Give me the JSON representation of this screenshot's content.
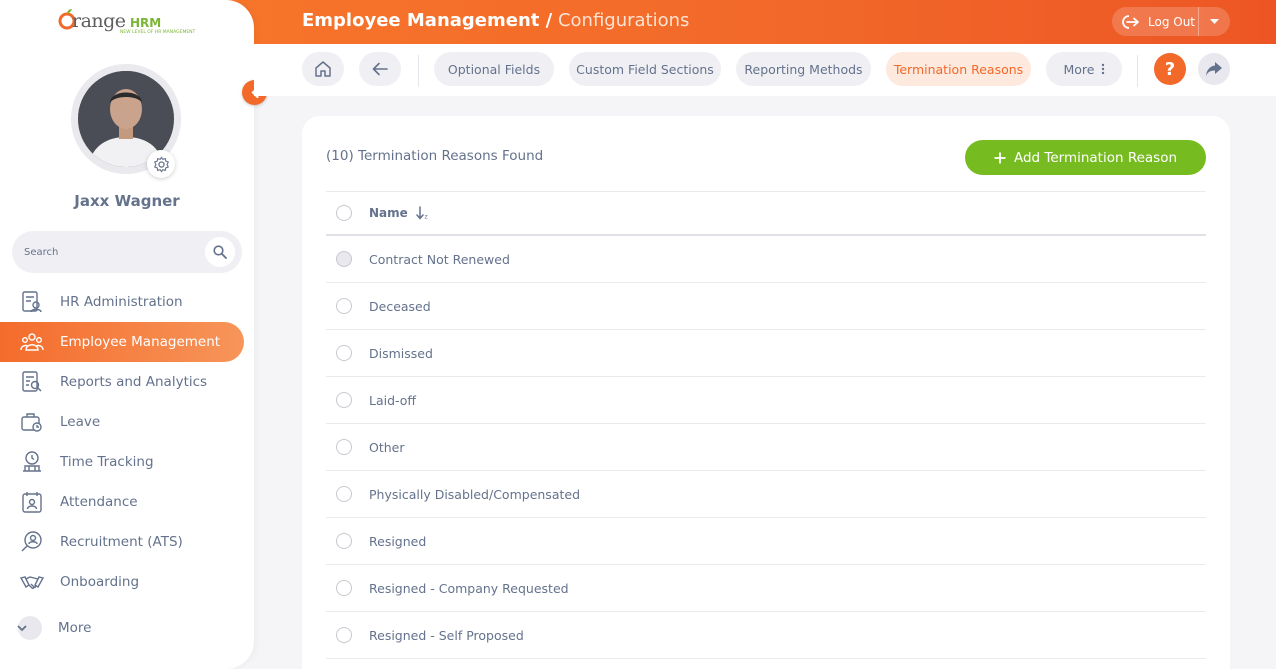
{
  "app": {
    "logo_main": "range",
    "logo_brand": "HRM",
    "logo_tagline": "NEW LEVEL OF HR MANAGEMENT"
  },
  "header": {
    "title": "Employee Management /",
    "subtitle": "Configurations",
    "logout_label": "Log Out"
  },
  "user": {
    "name": "Jaxx Wagner"
  },
  "search": {
    "placeholder": "Search"
  },
  "sidebar": {
    "items": [
      {
        "label": "HR Administration",
        "icon": "hr-admin-icon"
      },
      {
        "label": "Employee Management",
        "icon": "employees-icon",
        "active": true
      },
      {
        "label": "Reports and Analytics",
        "icon": "reports-icon"
      },
      {
        "label": "Leave",
        "icon": "leave-icon"
      },
      {
        "label": "Time Tracking",
        "icon": "time-tracking-icon"
      },
      {
        "label": "Attendance",
        "icon": "attendance-icon"
      },
      {
        "label": "Recruitment (ATS)",
        "icon": "recruitment-icon"
      },
      {
        "label": "Onboarding",
        "icon": "onboarding-icon"
      },
      {
        "label": "More",
        "icon": "chevron-down-icon"
      }
    ]
  },
  "tabs": [
    {
      "label": "Optional Fields"
    },
    {
      "label": "Custom Field Sections"
    },
    {
      "label": "Reporting Methods"
    },
    {
      "label": "Termination Reasons",
      "active": true
    },
    {
      "label": "More"
    }
  ],
  "help": {
    "label": "?"
  },
  "content": {
    "found_text": "(10) Termination Reasons Found",
    "add_button": "Add Termination Reason",
    "column_name": "Name",
    "rows": [
      "Contract Not Renewed",
      "Deceased",
      "Dismissed",
      "Laid-off",
      "Other",
      "Physically Disabled/Compensated",
      "Resigned",
      "Resigned - Company Requested",
      "Resigned - Self Proposed"
    ]
  },
  "colors": {
    "accent": "#f2692a",
    "success": "#76bc21",
    "text": "#64728c"
  }
}
